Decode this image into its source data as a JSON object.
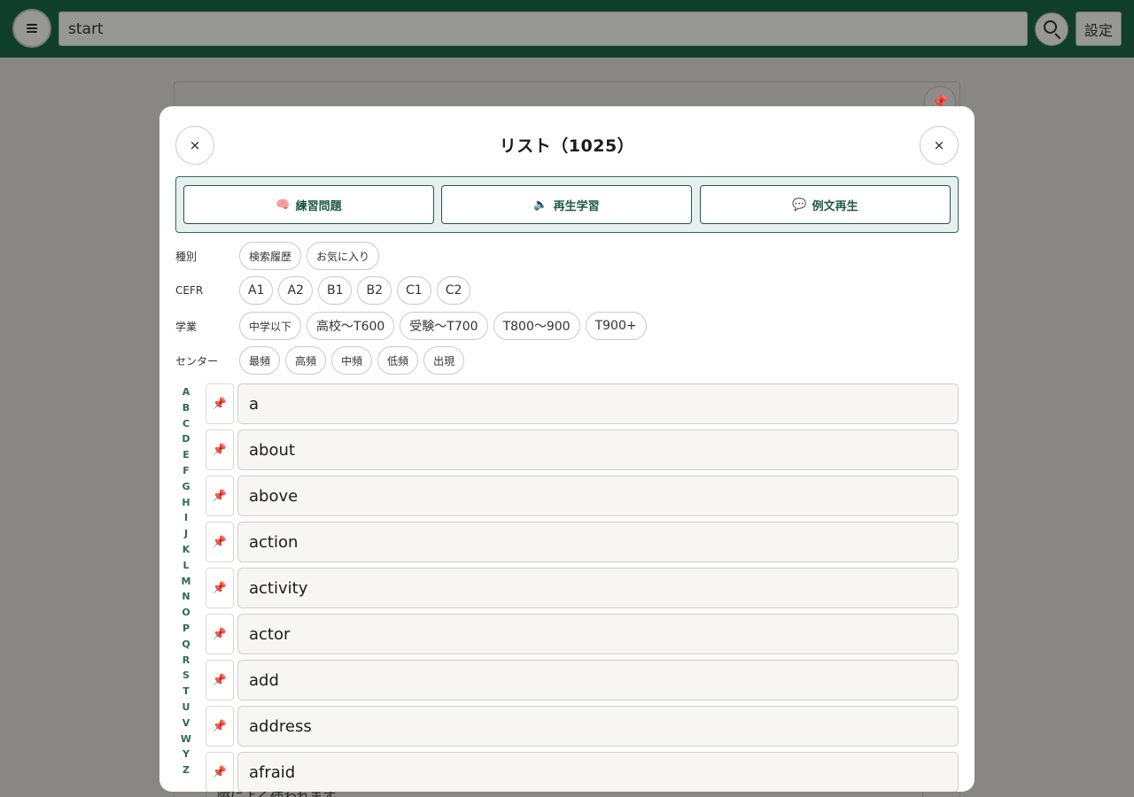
{
  "header": {
    "search_value": "start",
    "settings_label": "設定"
  },
  "background": {
    "footer_text": "際によく使われます"
  },
  "modal": {
    "title": "リスト（1025）",
    "close_label": "×",
    "actions": [
      {
        "icon": "🧠",
        "label": "練習問題"
      },
      {
        "icon": "🔈",
        "label": "再生学習"
      },
      {
        "icon": "💬",
        "label": "例文再生"
      }
    ],
    "filters": [
      {
        "label": "種別",
        "chips": [
          "検索履歴",
          "お気に入り"
        ]
      },
      {
        "label": "CEFR",
        "chips": [
          "A1",
          "A2",
          "B1",
          "B2",
          "C1",
          "C2"
        ]
      },
      {
        "label": "学業",
        "chips": [
          "中学以下",
          "高校〜T600",
          "受験〜T700",
          "T800〜900",
          "T900+"
        ]
      },
      {
        "label": "センター",
        "chips": [
          "最頻",
          "高頻",
          "中頻",
          "低頻",
          "出現"
        ]
      }
    ],
    "alphabet": [
      "A",
      "B",
      "C",
      "D",
      "E",
      "F",
      "G",
      "H",
      "I",
      "J",
      "K",
      "L",
      "M",
      "N",
      "O",
      "P",
      "Q",
      "R",
      "S",
      "T",
      "U",
      "V",
      "W",
      "Y",
      "Z"
    ],
    "pin_icon": "📌",
    "words": [
      "a",
      "about",
      "above",
      "action",
      "activity",
      "actor",
      "add",
      "address",
      "afraid"
    ]
  }
}
